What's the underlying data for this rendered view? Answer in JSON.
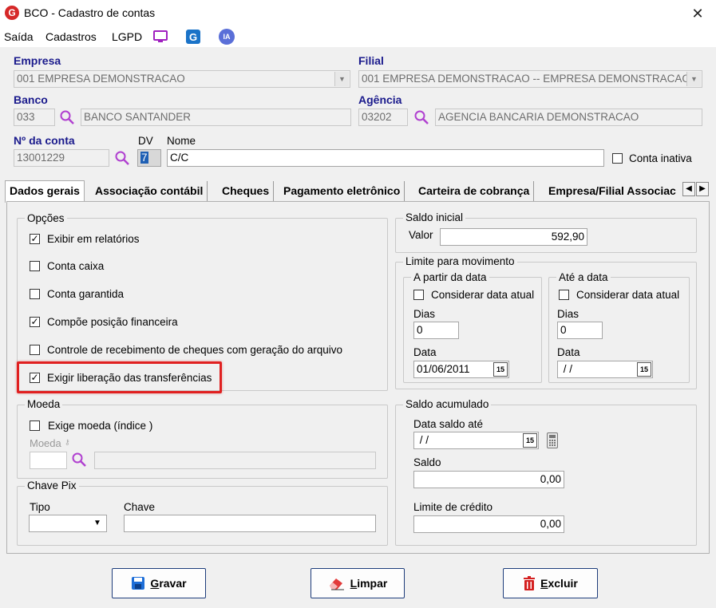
{
  "window": {
    "title": "BCO - Cadastro de contas",
    "close": "✕",
    "logo": "G"
  },
  "menu": {
    "items": [
      "Saída",
      "Cadastros",
      "LGPD"
    ],
    "ia_label": "IA"
  },
  "header": {
    "empresa_label": "Empresa",
    "empresa_value": "001 EMPRESA DEMONSTRACAO",
    "filial_label": "Filial",
    "filial_value": "001 EMPRESA DEMONSTRACAO -- EMPRESA DEMONSTRACAO",
    "banco_label": "Banco",
    "banco_code": "033",
    "banco_name": "BANCO SANTANDER",
    "agencia_label": "Agência",
    "agencia_code": "03202",
    "agencia_name": "AGENCIA BANCARIA DEMONSTRACAO",
    "conta_label": "Nº da conta",
    "conta_value": "13001229",
    "dv_label": "DV",
    "dv_value": "7",
    "nome_label": "Nome",
    "nome_value": "C/C",
    "inativa_label": "Conta inativa"
  },
  "tabs": [
    {
      "label": "Dados gerais",
      "active": true
    },
    {
      "label": "Associação contábil"
    },
    {
      "label": "Cheques"
    },
    {
      "label": "Pagamento eletrônico"
    },
    {
      "label": "Carteira de cobrança"
    },
    {
      "label": "Empresa/Filial Associac"
    }
  ],
  "opcoes": {
    "title": "Opções",
    "items": [
      {
        "label": "Exibir em relatórios",
        "checked": true
      },
      {
        "label": "Conta caixa",
        "checked": false
      },
      {
        "label": "Conta garantida",
        "checked": false
      },
      {
        "label": "Compõe posição financeira",
        "checked": true
      },
      {
        "label": "Controle de recebimento de cheques com geração do arquivo",
        "checked": false
      },
      {
        "label": "Exigir liberação das transferências",
        "checked": true
      }
    ]
  },
  "moeda": {
    "title": "Moeda",
    "exige_label": "Exige moeda (índice )",
    "moeda_label": "Moeda"
  },
  "pix": {
    "title": "Chave Pix",
    "tipo_label": "Tipo",
    "chave_label": "Chave"
  },
  "saldo_inicial": {
    "title": "Saldo inicial",
    "valor_label": "Valor",
    "valor": "592,90"
  },
  "limite": {
    "title": "Limite para movimento",
    "a_partir": {
      "title": "A partir da data",
      "considerar": "Considerar data atual",
      "dias_label": "Dias",
      "dias": "0",
      "data_label": "Data",
      "data": "01/06/2011"
    },
    "ate": {
      "title": "Até a data",
      "considerar": "Considerar data atual",
      "dias_label": "Dias",
      "dias": "0",
      "data_label": "Data",
      "data": " / /"
    }
  },
  "saldo_acumulado": {
    "title": "Saldo acumulado",
    "data_label": "Data saldo até",
    "data": " / /",
    "saldo_label": "Saldo",
    "saldo": "0,00",
    "limite_label": "Limite de crédito",
    "limite": "0,00"
  },
  "buttons": {
    "gravar_ul": "G",
    "gravar_rest": "ravar",
    "limpar_ul": "L",
    "limpar_rest": "impar",
    "excluir_ul": "E",
    "excluir_rest": "xcluir"
  },
  "date_btn": "15",
  "colors": {
    "accent": "#1a1a8c",
    "highlight": "#e02020",
    "button_border": "#1e3d7b"
  }
}
